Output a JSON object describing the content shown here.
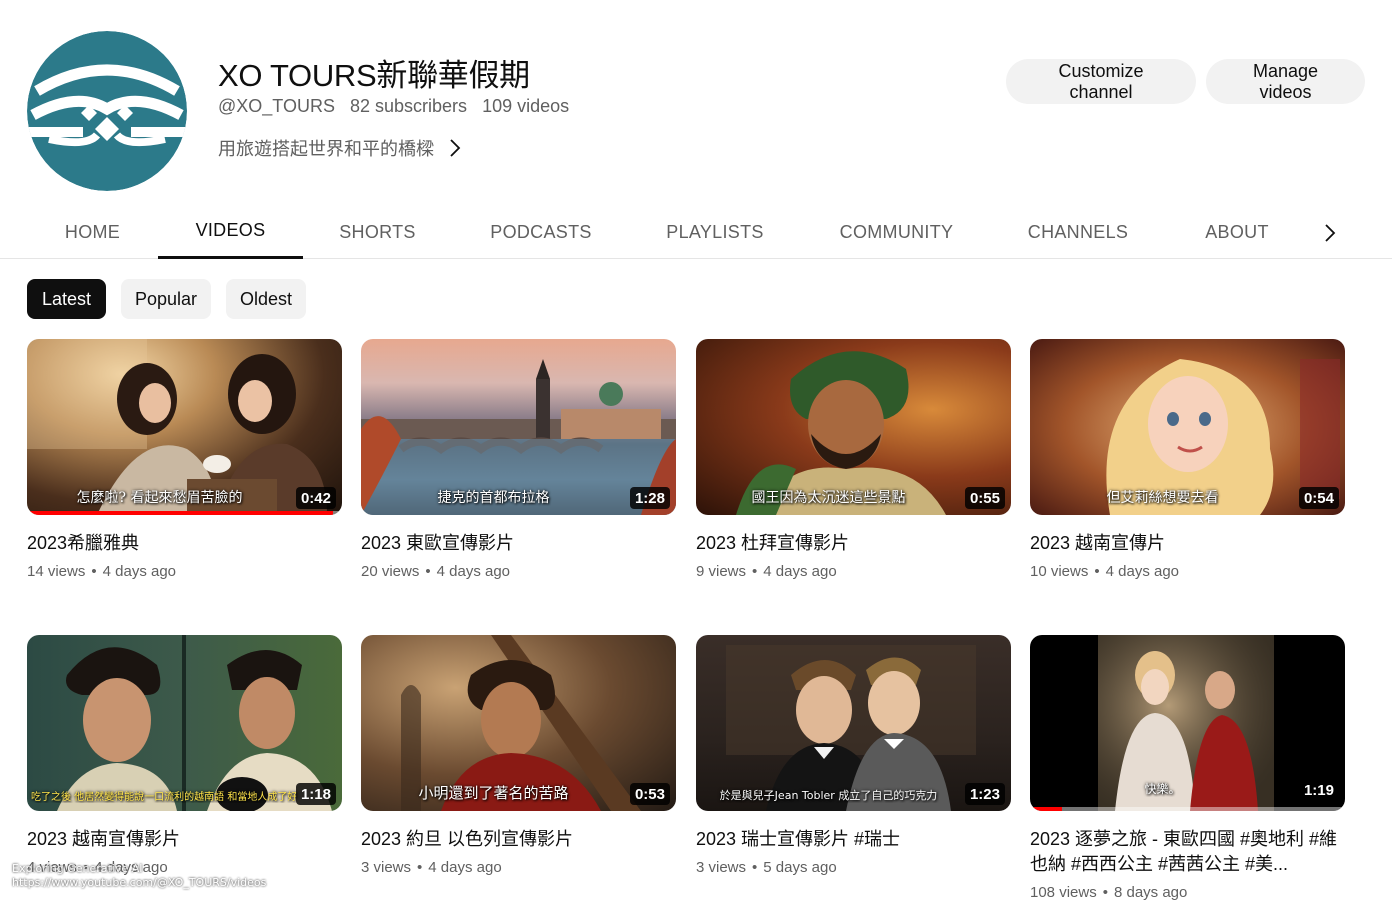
{
  "channel": {
    "name": "XO TOURS新聯華假期",
    "handle": "@XO_TOURS",
    "subscribers": "82 subscribers",
    "video_count": "109 videos",
    "description": "用旅遊搭起世界和平的橋樑",
    "logo_color": "#2c7a8a"
  },
  "actions": {
    "customize_label": "Customize channel",
    "manage_label": "Manage videos"
  },
  "tabs": [
    {
      "label": "HOME"
    },
    {
      "label": "VIDEOS",
      "active": true
    },
    {
      "label": "SHORTS"
    },
    {
      "label": "PODCASTS"
    },
    {
      "label": "PLAYLISTS"
    },
    {
      "label": "COMMUNITY"
    },
    {
      "label": "CHANNELS"
    },
    {
      "label": "ABOUT"
    }
  ],
  "filters": [
    {
      "label": "Latest",
      "active": true
    },
    {
      "label": "Popular"
    },
    {
      "label": "Oldest"
    }
  ],
  "videos": [
    {
      "title": "2023希臘雅典",
      "views": "14 views",
      "age": "4 days ago",
      "duration": "0:42",
      "caption": "怎麼啦? 看起來愁眉苦臉的",
      "watched_fraction": 0.97
    },
    {
      "title": "2023 東歐宣傳影片",
      "views": "20 views",
      "age": "4 days ago",
      "duration": "1:28",
      "caption": "捷克的首都布拉格"
    },
    {
      "title": "2023 杜拜宣傳影片",
      "views": "9 views",
      "age": "4 days ago",
      "duration": "0:55",
      "caption": "國王因為太沉迷這些景點"
    },
    {
      "title": "2023 越南宣傳片",
      "views": "10 views",
      "age": "4 days ago",
      "duration": "0:54",
      "caption": "但艾莉絲想要去看"
    },
    {
      "title": "2023 越南宣傳影片",
      "views": "4 views",
      "age": "4 days ago",
      "duration": "1:18",
      "caption": "吃了之後 他居然變得能說一口流利的越南語 和當地人成了好"
    },
    {
      "title": "2023 約旦 以色列宣傳影片",
      "views": "3 views",
      "age": "4 days ago",
      "duration": "0:53",
      "caption": "小明還到了著名的苦路"
    },
    {
      "title": "2023 瑞士宣傳影片 #瑞士",
      "views": "3 views",
      "age": "5 days ago",
      "duration": "1:23",
      "caption": "於是與兒子Jean Tobler 成立了自己的巧克力"
    },
    {
      "title": "2023 逐夢之旅 - 東歐四國 #奧地利 #維也納 #西西公主 #茜茜公主 #美...",
      "views": "108 views",
      "age": "8 days ago",
      "duration": "1:19",
      "caption": "快樂。",
      "watched_fraction": 0.1
    }
  ],
  "status_bar": {
    "line1": "Exploring Generative AI",
    "line2": "https://www.youtube.com/@XO_TOURS/videos"
  }
}
